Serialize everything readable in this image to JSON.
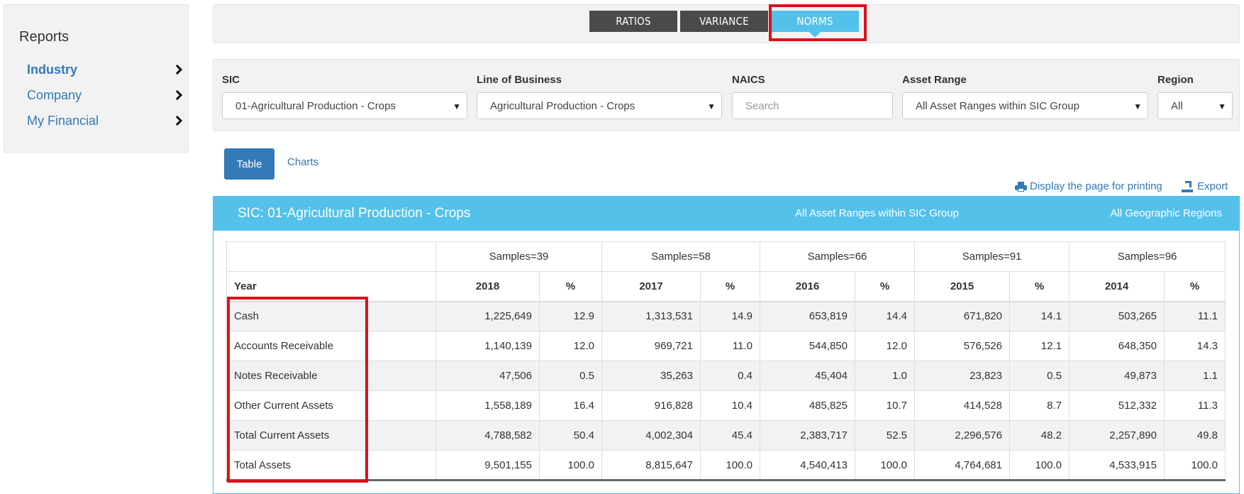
{
  "sidebar": {
    "title": "Reports",
    "items": [
      {
        "label": "Industry"
      },
      {
        "label": "Company"
      },
      {
        "label": "My Financial"
      }
    ]
  },
  "tabs": [
    {
      "label": "RATIOS"
    },
    {
      "label": "VARIANCE"
    },
    {
      "label": "NORMS"
    }
  ],
  "filters": {
    "sic": {
      "label": "SIC",
      "value": "01-Agricultural Production - Crops"
    },
    "lob": {
      "label": "Line of Business",
      "value": "Agricultural Production - Crops"
    },
    "naics": {
      "label": "NAICS",
      "placeholder": "Search"
    },
    "asset": {
      "label": "Asset Range",
      "value": "All Asset Ranges within SIC Group"
    },
    "region": {
      "label": "Region",
      "value": "All"
    }
  },
  "view": {
    "table_label": "Table",
    "charts_label": "Charts"
  },
  "utilities": {
    "print_label": "Display the page for printing",
    "export_label": "Export"
  },
  "panel": {
    "title": "SIC: 01-Agricultural Production - Crops",
    "asset_range": "All Asset Ranges within SIC Group",
    "region": "All Geographic Regions"
  },
  "table": {
    "samples": [
      "Samples=39",
      "Samples=58",
      "Samples=66",
      "Samples=91",
      "Samples=96"
    ],
    "year_label": "Year",
    "years": [
      "2018",
      "2017",
      "2016",
      "2015",
      "2014"
    ],
    "pct": "%",
    "rows": [
      {
        "label": "Cash",
        "cells": [
          "1,225,649",
          "12.9",
          "1,313,531",
          "14.9",
          "653,819",
          "14.4",
          "671,820",
          "14.1",
          "503,265",
          "11.1"
        ]
      },
      {
        "label": "Accounts Receivable",
        "cells": [
          "1,140,139",
          "12.0",
          "969,721",
          "11.0",
          "544,850",
          "12.0",
          "576,526",
          "12.1",
          "648,350",
          "14.3"
        ]
      },
      {
        "label": "Notes Receivable",
        "cells": [
          "47,506",
          "0.5",
          "35,263",
          "0.4",
          "45,404",
          "1.0",
          "23,823",
          "0.5",
          "49,873",
          "1.1"
        ]
      },
      {
        "label": "Other Current Assets",
        "cells": [
          "1,558,189",
          "16.4",
          "916,828",
          "10.4",
          "485,825",
          "10.7",
          "414,528",
          "8.7",
          "512,332",
          "11.3"
        ]
      },
      {
        "label": "Total Current Assets",
        "cells": [
          "4,788,582",
          "50.4",
          "4,002,304",
          "45.4",
          "2,383,717",
          "52.5",
          "2,296,576",
          "48.2",
          "2,257,890",
          "49.8"
        ]
      },
      {
        "label": "Total Assets",
        "cells": [
          "9,501,155",
          "100.0",
          "8,815,647",
          "100.0",
          "4,540,413",
          "100.0",
          "4,764,681",
          "100.0",
          "4,533,915",
          "100.0"
        ]
      }
    ]
  },
  "colors": {
    "accent": "#54c1ea",
    "link": "#337ab7",
    "highlight": "#d9121a",
    "dark_tab": "#4a4a4a"
  }
}
